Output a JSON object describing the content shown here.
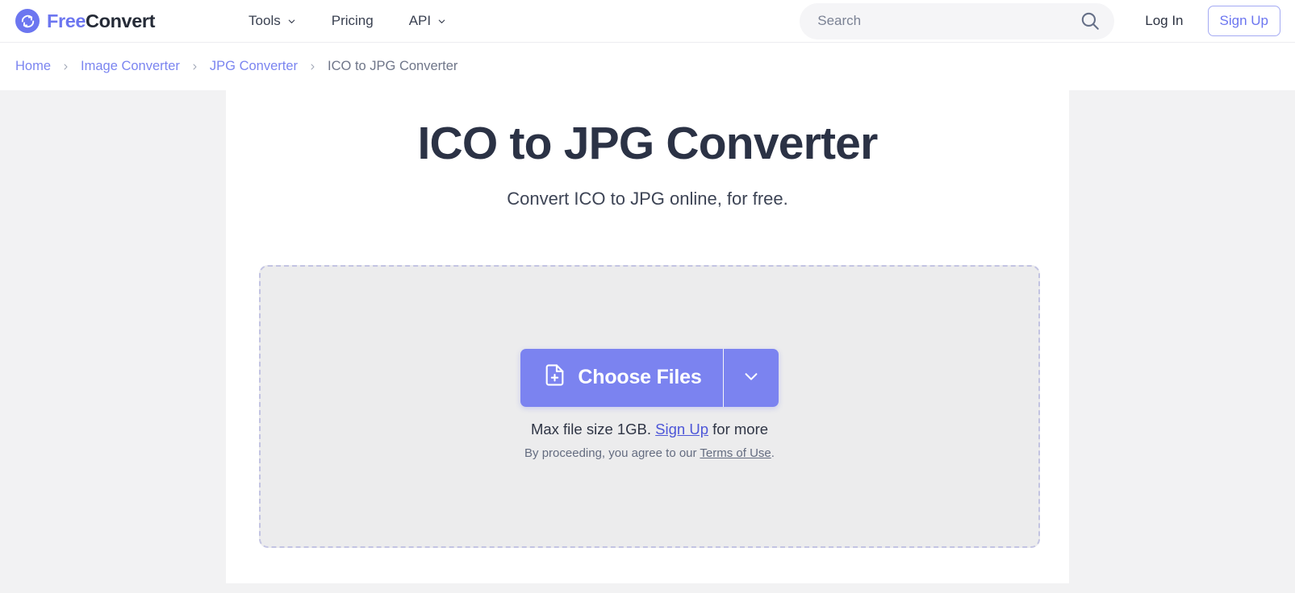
{
  "header": {
    "brand": {
      "first": "Free",
      "second": "Convert",
      "icon": "refresh-circle-icon"
    },
    "nav": [
      {
        "label": "Tools",
        "has_caret": true
      },
      {
        "label": "Pricing",
        "has_caret": false
      },
      {
        "label": "API",
        "has_caret": true
      }
    ],
    "search": {
      "placeholder": "Search",
      "value": "",
      "icon": "search-icon"
    },
    "login_label": "Log In",
    "signup_label": "Sign Up"
  },
  "breadcrumb": {
    "separator": "›",
    "items": [
      {
        "label": "Home",
        "current": false
      },
      {
        "label": "Image Converter",
        "current": false
      },
      {
        "label": "JPG Converter",
        "current": false
      },
      {
        "label": "ICO to JPG Converter",
        "current": true
      }
    ]
  },
  "main": {
    "title": "ICO to JPG Converter",
    "subtitle": "Convert ICO to JPG online, for free.",
    "dropzone": {
      "choose_files_label": "Choose Files",
      "file_icon": "file-plus-icon",
      "caret_icon": "chevron-down-icon",
      "note_prefix": "Max file size 1GB.",
      "note_link": "Sign Up",
      "note_suffix": "for more",
      "terms_prefix": "By proceeding, you agree to our",
      "terms_link": "Terms of Use",
      "terms_suffix": "."
    }
  },
  "colors": {
    "brand_purple": "#6c76f0",
    "button_purple": "#7b83f0",
    "link_purple": "#7b85f0",
    "heading_dark": "#2b3245",
    "dropzone_fill": "#ececed",
    "dropzone_border": "#c3c4e2"
  }
}
